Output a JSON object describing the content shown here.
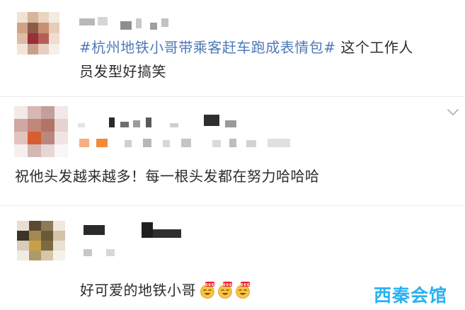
{
  "post": {
    "hashtag": "#杭州地铁小哥带乘客赶车跑成表情包#",
    "text_line1": " 这个工作人",
    "text_line2": "员发型好搞笑"
  },
  "comments": [
    {
      "text": "祝他头发越来越多！每一根头发都在努力哈哈哈"
    },
    {
      "text": "好可爱的地铁小哥"
    }
  ],
  "emoji_badge": "666",
  "watermark": "西秦会馆",
  "icons": [
    "collapse-chevron-icon",
    "laughing-666-emoji"
  ],
  "colors": {
    "hashtag": "#5079b8",
    "text": "#2b2b2b",
    "watermark": "#29b2f2",
    "badge": "#e8232b",
    "emoji_face": "#f6c344"
  }
}
